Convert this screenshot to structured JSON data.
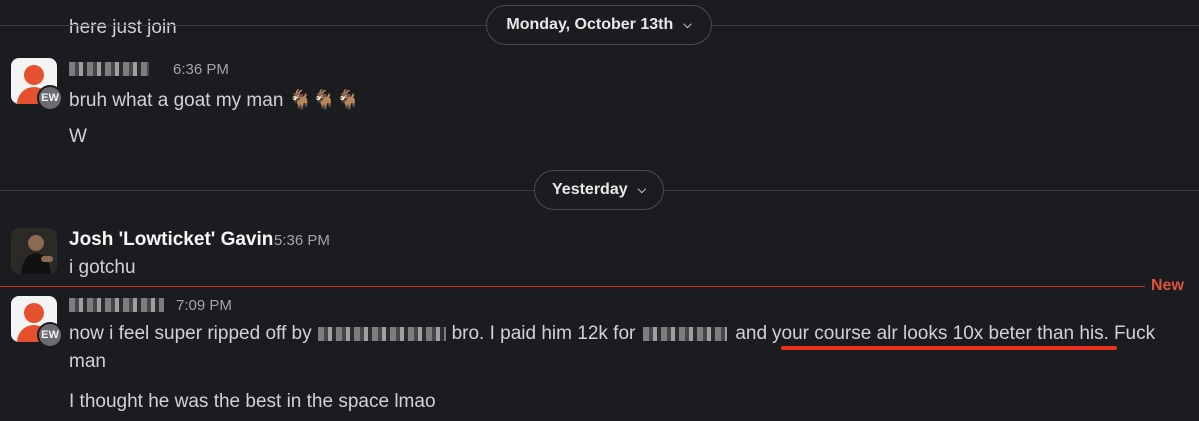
{
  "messages": {
    "m0": {
      "text": "here just join"
    },
    "m1": {
      "time": "6:36 PM",
      "badge": "EW",
      "lines": [
        "bruh what a goat my man 🐐🐐🐐",
        "W"
      ]
    },
    "m2": {
      "name": "Josh 'Lowticket' Gavin",
      "time": "5:36 PM",
      "lines": [
        "i gotchu"
      ]
    },
    "m3": {
      "time": "7:09 PM",
      "badge": "EW",
      "line1_a": "now i feel super ripped off by",
      "line1_b": "bro. I paid him 12k for",
      "line1_c": "and",
      "line1_highlight": "your course alr looks 10x beter than his.",
      "line1_d": "Fuck",
      "line2": "man",
      "line3": "I thought he was the best in the space lmao"
    }
  },
  "dividers": {
    "d1": {
      "label": "Monday, October 13th",
      "icon": "chevron-down-icon"
    },
    "d2": {
      "label": "Yesterday",
      "icon": "chevron-down-icon"
    }
  },
  "new_marker": {
    "label": "New",
    "color": "#e0533d"
  },
  "colors": {
    "background": "#1b1c1f",
    "highlight_underline": "#e8301f",
    "avatar_accent": "#e5502f"
  }
}
